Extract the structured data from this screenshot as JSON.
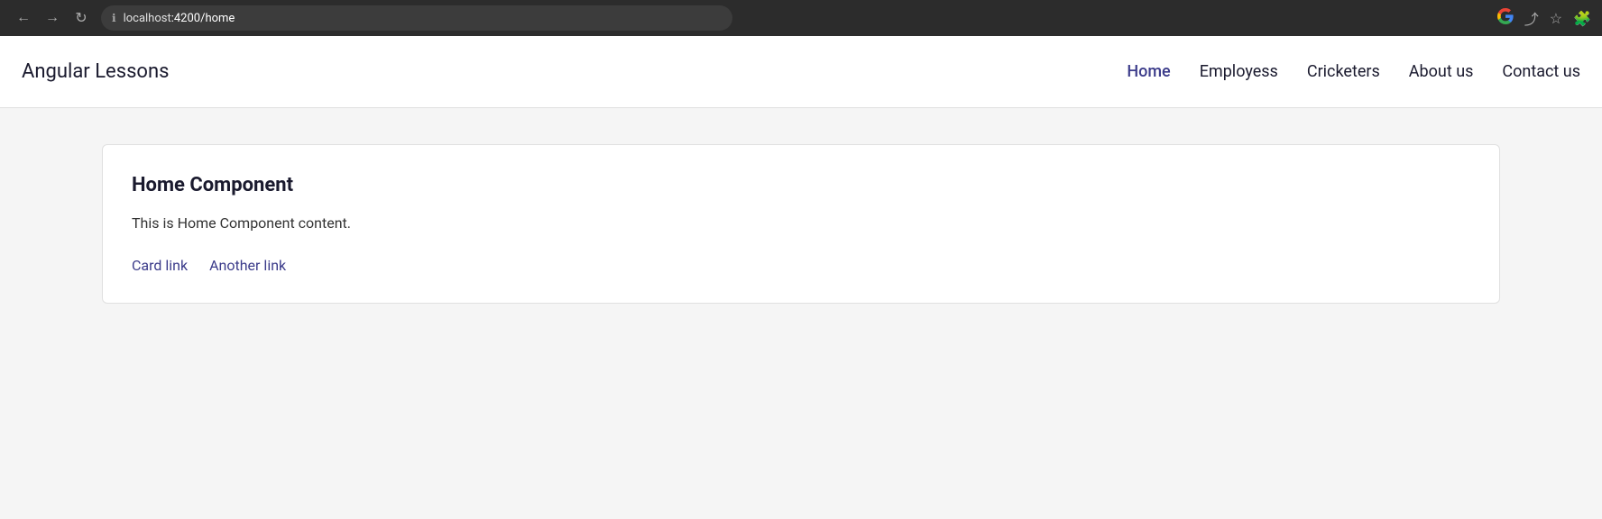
{
  "browser": {
    "url_prefix": "localhost",
    "url_path": ":4200/home",
    "back_label": "←",
    "forward_label": "→",
    "reload_label": "↻"
  },
  "navbar": {
    "brand": "Angular Lessons",
    "links": [
      {
        "label": "Home",
        "active": true
      },
      {
        "label": "Employess",
        "active": false
      },
      {
        "label": "Cricketers",
        "active": false
      },
      {
        "label": "About us",
        "active": false
      },
      {
        "label": "Contact us",
        "active": false
      }
    ]
  },
  "card": {
    "title": "Home Component",
    "content": "This is Home Component content.",
    "link1": "Card link",
    "link2": "Another link"
  }
}
